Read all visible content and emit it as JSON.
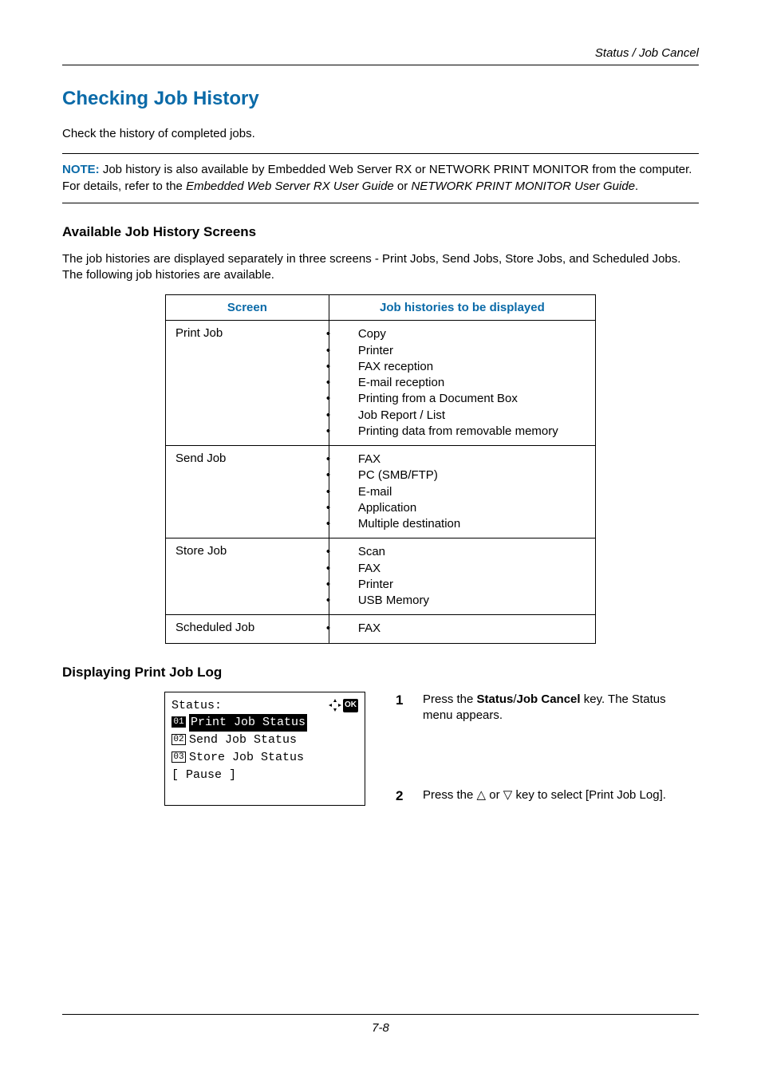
{
  "header": {
    "section_title": "Status / Job Cancel"
  },
  "h1": "Checking Job History",
  "intro": "Check the history of completed jobs.",
  "note": {
    "label": "NOTE:",
    "text_before_italic1": " Job history is also available by Embedded Web Server RX or NETWORK PRINT MONITOR from the computer. For details, refer to the ",
    "italic1": "Embedded Web Server RX User Guide",
    "mid": " or ",
    "italic2": "NETWORK PRINT MONITOR User Guide",
    "tail": "."
  },
  "h2a": "Available Job History Screens",
  "para_a": "The job histories are displayed separately in three screens - Print Jobs, Send Jobs, Store Jobs, and Scheduled Jobs. The following job histories are available.",
  "table": {
    "head": [
      "Screen",
      "Job histories to be displayed"
    ],
    "rows": [
      {
        "screen": "Print Job",
        "items": [
          "Copy",
          "Printer",
          "FAX reception",
          "E-mail reception",
          "Printing from a Document Box",
          "Job Report / List",
          "Printing data from removable memory"
        ]
      },
      {
        "screen": "Send Job",
        "items": [
          "FAX",
          "PC (SMB/FTP)",
          "E-mail",
          "Application",
          "Multiple destination"
        ]
      },
      {
        "screen": "Store Job",
        "items": [
          "Scan",
          "FAX",
          "Printer",
          "USB Memory"
        ]
      },
      {
        "screen": "Scheduled Job",
        "items": [
          "FAX"
        ]
      }
    ]
  },
  "h2b": "Displaying Print Job Log",
  "lcd": {
    "title": "Status:",
    "row1": {
      "num": "01",
      "text": "Print Job Status"
    },
    "row2": {
      "num": "02",
      "text": "Send Job Status"
    },
    "row3": {
      "num": "03",
      "text": "Store Job Status"
    },
    "softkey": "[ Pause  ]"
  },
  "steps": {
    "s1": {
      "num": "1",
      "before_bold": "Press the ",
      "bold1": "Status",
      "slash": "/",
      "bold2": "Job Cancel",
      "after_bold": " key. The Status menu appears."
    },
    "s2": {
      "num": "2",
      "before_tri": "Press the ",
      "mid": " or ",
      "after_tri": " key to select [Print Job Log]."
    }
  },
  "footer": {
    "pagenum": "7-8"
  },
  "glyphs": {
    "tri_up": "△",
    "tri_down": "▽",
    "nav": "✦",
    "ok": "OK"
  }
}
